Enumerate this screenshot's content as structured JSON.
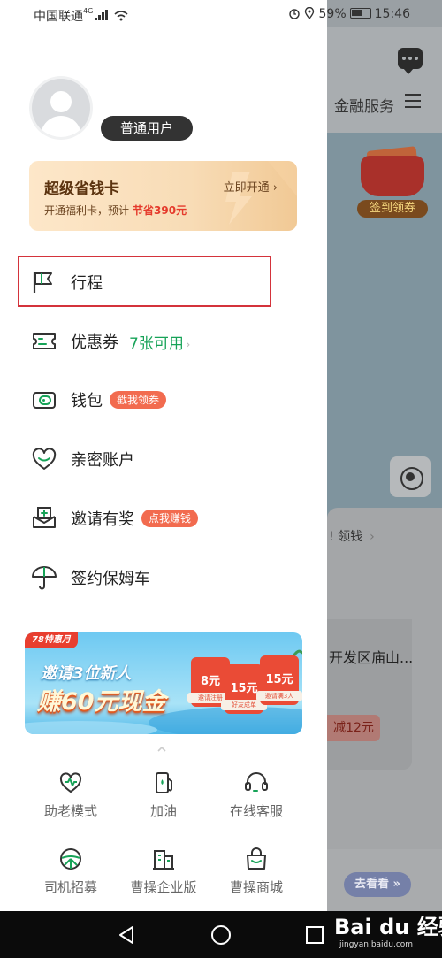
{
  "status_bar": {
    "carrier": "中国联通",
    "network": "4G",
    "battery": "59%",
    "time": "15:46"
  },
  "background_app": {
    "tab_label": "金融服务",
    "coupon_label": "签到领券",
    "card_text": "! 领钱",
    "address_text": "开发区庙山...",
    "discount_text": "减12元",
    "goto_button": "去看看 »"
  },
  "drawer": {
    "user": {
      "role_label": "普通用户"
    },
    "vip_card": {
      "title": "超级省钱卡",
      "open_label": "立即开通",
      "subtitle": "开通福利卡，预计",
      "save_text": "节省390元"
    },
    "menu": [
      {
        "label": "行程",
        "icon": "flag-icon"
      },
      {
        "label": "优惠券",
        "icon": "coupon-icon",
        "extra": "7张可用"
      },
      {
        "label": "钱包",
        "icon": "wallet-icon",
        "tag": "戳我领券"
      },
      {
        "label": "亲密账户",
        "icon": "heart-icon"
      },
      {
        "label": "邀请有奖",
        "icon": "invite-mail-icon",
        "tag": "点我赚钱"
      },
      {
        "label": "签约保姆车",
        "icon": "umbrella-icon"
      }
    ],
    "promo": {
      "tag": "78特惠月",
      "line1": "邀请3位新人",
      "line2": "赚60元现金",
      "tickets": [
        {
          "amount": "8元",
          "caption": "邀请注册"
        },
        {
          "amount": "15元",
          "caption": "好友成单"
        },
        {
          "amount": "15元",
          "caption": "邀请满3人"
        }
      ]
    },
    "quick_actions": [
      {
        "label": "助老模式",
        "icon": "elder-heart-icon"
      },
      {
        "label": "加油",
        "icon": "fuel-icon"
      },
      {
        "label": "在线客服",
        "icon": "headset-icon"
      },
      {
        "label": "司机招募",
        "icon": "steering-wheel-icon"
      },
      {
        "label": "曹操企业版",
        "icon": "building-icon"
      },
      {
        "label": "曹操商城",
        "icon": "shopping-bag-icon"
      }
    ]
  },
  "watermark": {
    "brand": "Bai du 经验",
    "url": "jingyan.baidu.com"
  },
  "colors": {
    "accent_green": "#17a358",
    "tag_orange": "#f26b4f",
    "highlight_red": "#d4333b",
    "vip_gold": "#5c3410"
  }
}
